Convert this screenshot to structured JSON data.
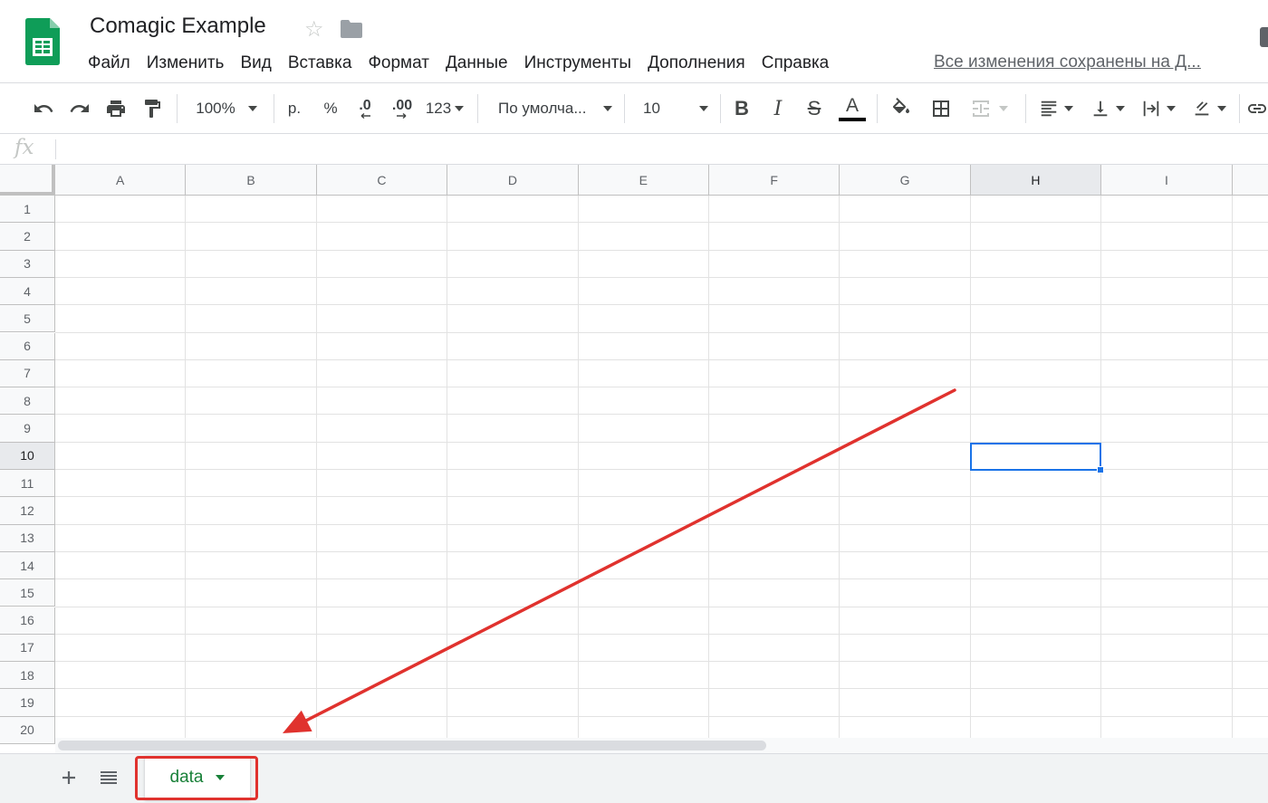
{
  "title_bar": {
    "document_title": "Comagic Example",
    "star_icon": "star-icon",
    "folder_icon": "folder-icon",
    "save_status": "Все изменения сохранены на Д..."
  },
  "menu": {
    "items": [
      {
        "label": "Файл"
      },
      {
        "label": "Изменить"
      },
      {
        "label": "Вид"
      },
      {
        "label": "Вставка"
      },
      {
        "label": "Формат"
      },
      {
        "label": "Данные"
      },
      {
        "label": "Инструменты"
      },
      {
        "label": "Дополнения"
      },
      {
        "label": "Справка"
      }
    ]
  },
  "toolbar": {
    "zoom": "100%",
    "currency": "р.",
    "percent": "%",
    "decrease_decimals": ".0",
    "increase_decimals": ".00",
    "more_formats": "123",
    "font_family": "По умолча...",
    "font_size": "10",
    "bold": "B",
    "italic": "I",
    "strikethrough": "S",
    "text_color": "A"
  },
  "formula_bar": {
    "fx_label": "fx",
    "value": ""
  },
  "grid": {
    "columns": [
      "A",
      "B",
      "C",
      "D",
      "E",
      "F",
      "G",
      "H",
      "I"
    ],
    "rows": [
      "1",
      "2",
      "3",
      "4",
      "5",
      "6",
      "7",
      "8",
      "9",
      "10",
      "11",
      "12",
      "13",
      "14",
      "15",
      "16",
      "17",
      "18",
      "19",
      "20"
    ],
    "active_column": "H",
    "active_row": "10",
    "selected_cell": "H10"
  },
  "sheets": {
    "tabs": [
      {
        "label": "data",
        "active": true
      }
    ]
  },
  "colors": {
    "sheets_green": "#188038",
    "selection_blue": "#1a73e8",
    "annotation_red": "#e0322e",
    "logo_green": "#0f9d58"
  }
}
